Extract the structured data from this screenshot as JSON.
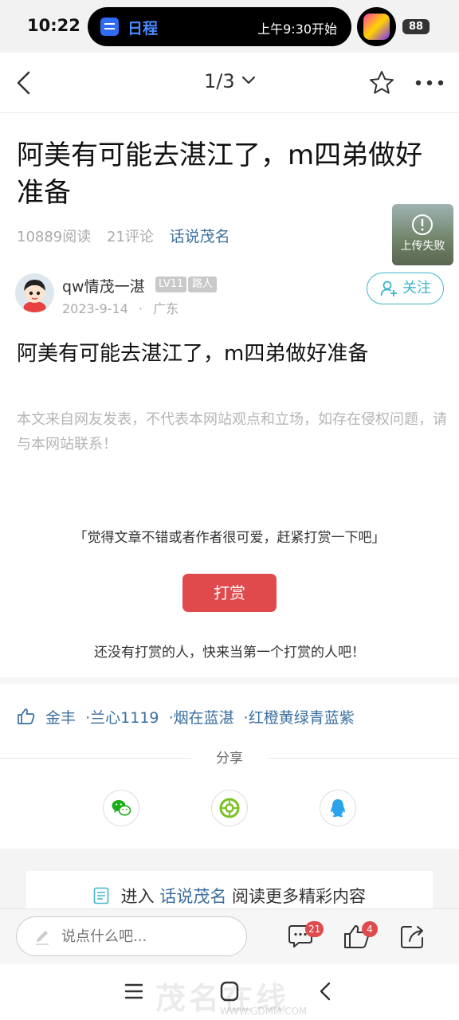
{
  "status_bar": {
    "time": "10:22",
    "island_app": "日程",
    "island_text": "上午9:30开始",
    "battery": "88"
  },
  "header": {
    "page_indicator": "1/3"
  },
  "article": {
    "title": "阿美有可能去湛江了，m四弟做好准备",
    "reads": "10889阅读",
    "comments": "21评论",
    "topic": "话说茂名",
    "upload_status": "上传失败",
    "author": {
      "name": "qw情茂一湛",
      "level": "LV11",
      "role": "路人",
      "date": "2023-9-14",
      "region": "广东",
      "separator": "·"
    },
    "follow_label": "关注",
    "body": "阿美有可能去湛江了，m四弟做好准备",
    "disclaimer": "本文来自网友发表，不代表本网站观点和立场，如存在侵权问题，请与本网站联系！"
  },
  "reward": {
    "prompt": "「觉得文章不错或者作者很可爱，赶紧打赏一下吧」",
    "button_label": "打赏",
    "empty_text": "还没有打赏的人，快来当第一个打赏的人吧！"
  },
  "likes": {
    "users": [
      "金丰",
      "·兰心1119",
      "·烟在蓝湛",
      "·红橙黄绿青蓝紫"
    ]
  },
  "share": {
    "label": "分享",
    "targets": [
      "wechat-icon",
      "moments-icon",
      "qq-icon"
    ]
  },
  "enter_section": {
    "prefix": "进入",
    "topic": "话说茂名",
    "suffix": "阅读更多精彩内容"
  },
  "bottom_bar": {
    "comment_placeholder": "说点什么吧...",
    "comment_count": "21",
    "like_count": "4"
  },
  "watermark": {
    "text": "茂名在线",
    "url": "WWW.GDMM.COM"
  },
  "colors": {
    "accent_red": "#e04a4c",
    "link_blue": "#3b6fa0",
    "follow_teal": "#3fb5c8"
  }
}
